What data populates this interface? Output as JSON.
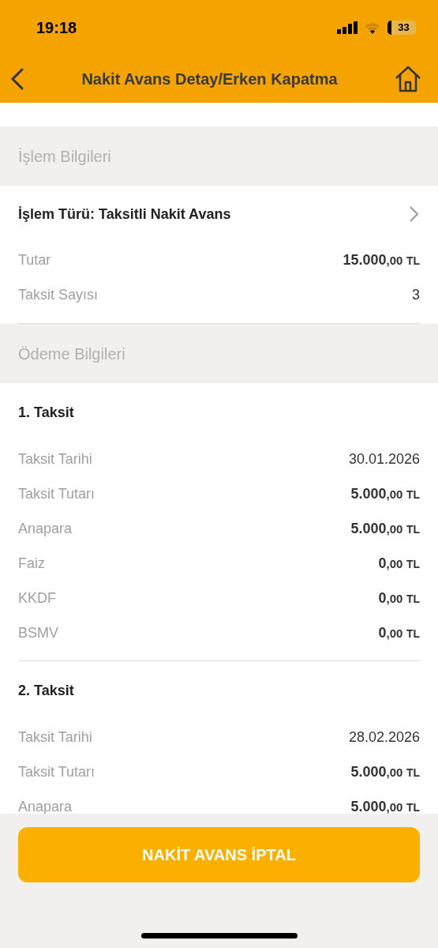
{
  "status_bar": {
    "time": "19:18",
    "battery": "33"
  },
  "header": {
    "title": "Nakit Avans Detay/Erken Kapatma"
  },
  "sections": [
    {
      "title": "İşlem Bilgileri",
      "link": "İşlem Türü: Taksitli Nakit Avans",
      "rows": [
        {
          "kind": "amount",
          "label": "Tutar",
          "value": "15.000",
          "decimals": ",00",
          "currency": "TL"
        },
        {
          "kind": "plain",
          "label": "Taksit Sayısı",
          "value": "3"
        }
      ]
    },
    {
      "title": "Ödeme Bilgileri",
      "installments": [
        {
          "title": "1. Taksit",
          "rows": [
            {
              "kind": "plain",
              "label": "Taksit Tarihi",
              "value": "30.01.2026"
            },
            {
              "kind": "amount",
              "label": "Taksit Tutarı",
              "value": "5.000",
              "decimals": ",00",
              "currency": "TL"
            },
            {
              "kind": "amount",
              "label": "Anapara",
              "value": "5.000",
              "decimals": ",00",
              "currency": "TL"
            },
            {
              "kind": "amount",
              "label": "Faiz",
              "value": "0",
              "decimals": ",00",
              "currency": "TL"
            },
            {
              "kind": "amount",
              "label": "KKDF",
              "value": "0",
              "decimals": ",00",
              "currency": "TL"
            },
            {
              "kind": "amount",
              "label": "BSMV",
              "value": "0",
              "decimals": ",00",
              "currency": "TL"
            }
          ]
        },
        {
          "title": "2. Taksit",
          "rows": [
            {
              "kind": "plain",
              "label": "Taksit Tarihi",
              "value": "28.02.2026"
            },
            {
              "kind": "amount",
              "label": "Taksit Tutarı",
              "value": "5.000",
              "decimals": ",00",
              "currency": "TL"
            },
            {
              "kind": "amount",
              "label": "Anapara",
              "value": "5.000",
              "decimals": ",00",
              "currency": "TL"
            }
          ]
        }
      ]
    }
  ],
  "button": "NAKİT AVANS İPTAL"
}
